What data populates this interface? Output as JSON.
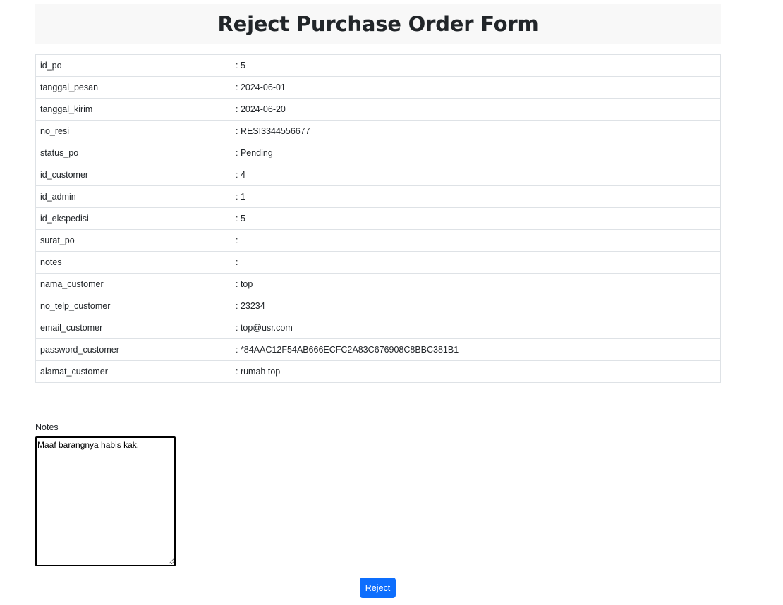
{
  "page": {
    "title": "Reject Purchase Order Form"
  },
  "details": [
    {
      "key": "id_po",
      "value": ": 5"
    },
    {
      "key": "tanggal_pesan",
      "value": ": 2024-06-01"
    },
    {
      "key": "tanggal_kirim",
      "value": ": 2024-06-20"
    },
    {
      "key": "no_resi",
      "value": ": RESI3344556677"
    },
    {
      "key": "status_po",
      "value": ": Pending"
    },
    {
      "key": "id_customer",
      "value": ": 4"
    },
    {
      "key": "id_admin",
      "value": ": 1"
    },
    {
      "key": "id_ekspedisi",
      "value": ": 5"
    },
    {
      "key": "surat_po",
      "value": ":"
    },
    {
      "key": "notes",
      "value": ":"
    },
    {
      "key": "nama_customer",
      "value": ": top"
    },
    {
      "key": "no_telp_customer",
      "value": ": 23234"
    },
    {
      "key": "email_customer",
      "value": ": top@usr.com"
    },
    {
      "key": "password_customer",
      "value": ": *84AAC12F54AB666ECFC2A83C676908C8BBC381B1"
    },
    {
      "key": "alamat_customer",
      "value": ": rumah top"
    }
  ],
  "form": {
    "notes_label": "Notes",
    "notes_value": "Maaf barangnya habis kak.",
    "submit_label": "Reject"
  }
}
